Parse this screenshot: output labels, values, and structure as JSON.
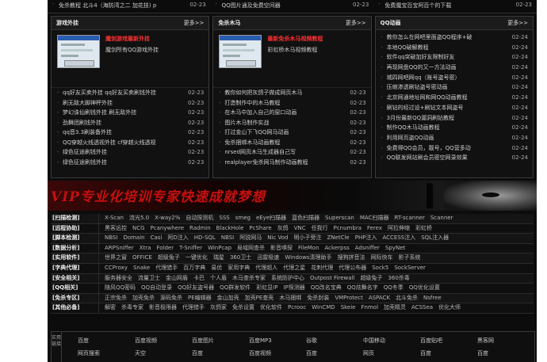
{
  "top_row": [
    {
      "text": "免杀教程 北斗4（海防湾之二 加花技) p",
      "date": "02-23"
    },
    {
      "text": "QQ图片通及免费空间器",
      "date": "02-23"
    },
    {
      "text": "免费魔宝百宝阿百个的下载",
      "date": "02-23"
    }
  ],
  "panels": [
    {
      "title": "游戏外挂",
      "more": "更多>>",
      "featured_title": "魔剑游戏最新外挂",
      "featured_desc": "魔剑所有QQ游戏外挂",
      "items": [
        {
          "text": "qq好友买卖外挂 qq好友买卖刷钱外挂",
          "date": "02-23"
        },
        {
          "text": "刷无敌大脚神秤外挂",
          "date": "02-23"
        },
        {
          "text": "梦幻诛仙刷钱外挂 刷无敌外挂",
          "date": "02-23"
        },
        {
          "text": "劲舞团刷钱外挂",
          "date": "02-23"
        },
        {
          "text": "qq音3.3刷装备外挂",
          "date": "02-23"
        },
        {
          "text": "QQ穿越火线透视外挂 cf穿越火线透视",
          "date": "02-23"
        },
        {
          "text": "绿色征途刷钱外挂",
          "date": "02-23"
        },
        {
          "text": "绿色征途刷钱外挂",
          "date": "02-23"
        }
      ]
    },
    {
      "title": "免杀木马",
      "more": "更多>>",
      "featured_title": "最新免杀木马视频教程",
      "featured_desc": "彩虹桥木马视频教程",
      "items": [
        {
          "text": "教你如何把灰鸽子做成网页木马",
          "date": "02-23"
        },
        {
          "text": "打造制作中的木马教程",
          "date": "02-23"
        },
        {
          "text": "在木马中加入自己的窗口动画",
          "date": "02-23"
        },
        {
          "text": "图片木马制作实战",
          "date": "02-23"
        },
        {
          "text": "打过金山下飞QQ网马动画",
          "date": "02-23"
        },
        {
          "text": "免杀捆绑木马动画教程",
          "date": "02-23"
        },
        {
          "text": "nrsed网页木马生成器自己写",
          "date": "02-23"
        },
        {
          "text": "realplayer免杀网马制作动画教程",
          "date": "02-23"
        }
      ]
    },
    {
      "title": "QQ动画",
      "more": "更多>>",
      "items": [
        {
          "text": "教你怎么在网吧里面盗QQ程序+破",
          "date": "02-24"
        },
        {
          "text": "本地QQ破解教程",
          "date": "02-24"
        },
        {
          "text": "软件qq突破加好友限制好友",
          "date": "02-24"
        },
        {
          "text": "再现网盘QQ的又一方法动画",
          "date": "02-24"
        },
        {
          "text": "城四网吧网qq（账号盗号密）",
          "date": "02-24"
        },
        {
          "text": "压缩渗透刷钻盗号密动画",
          "date": "02-24"
        },
        {
          "text": "北京网通地址网和网QQ动画教程",
          "date": "02-24"
        },
        {
          "text": "刷钻的经过设+刷钻文本网盗号",
          "date": "02-24"
        },
        {
          "text": "3月份最新QQ漏洞刷钻教程",
          "date": "02-24"
        },
        {
          "text": "制作QQ木马动画教程",
          "date": "02-24"
        },
        {
          "text": "利用网页盗QQ动画",
          "date": "02-24"
        },
        {
          "text": "免费得QQ会员，靓号，QQ营多动",
          "date": "02-24"
        },
        {
          "text": "QQ联发网站刷会员密空网录效果",
          "date": "02-24"
        }
      ]
    }
  ],
  "banner": {
    "text": "VIP专业化培训专家快速成就梦想"
  },
  "nav": [
    {
      "label": "[扫描检测]",
      "items": [
        "X-Scan",
        "流光5.0",
        "X-way2%",
        "自动探测机",
        "SSS",
        "smeg",
        "eEye扫描器",
        "蓝色扫描器",
        "Superscan",
        "MAC扫描器",
        "RT-scanner",
        "Scanner"
      ]
    },
    {
      "label": "[远程协助]",
      "items": [
        "黑客远控",
        "NCG",
        "Pcanywhere",
        "Radmin",
        "BlackHole",
        "PcShare",
        "灰鸽",
        "VNC",
        "任我行",
        "Pcnumbra",
        "Ferex",
        "阿拉伸缩",
        "彩虹桥"
      ]
    },
    {
      "label": "[脚本检测]",
      "items": [
        "NBSI",
        "Domain",
        "Casi",
        "阿D注入",
        "HD-SQL",
        "NBSI",
        "阿锐网马",
        "Nic Vod",
        "明小子旁注",
        "ZNetCle",
        "PHP注入",
        "ACCESS注入",
        "SQL注入器"
      ]
    },
    {
      "label": "[数据分析]",
      "items": [
        "ARPSniffer",
        "Xtra",
        "Folder",
        "T-Sniffer",
        "WinPcap",
        "局域网查杀",
        "影音嗅探",
        "FileMon",
        "Ackerpss",
        "Adsniffer",
        "SpyNet"
      ]
    },
    {
      "label": "[实用软件]",
      "items": [
        "世界之窗",
        "OFFICE",
        "超级兔子",
        "一键优化",
        "瑞星",
        "360卫士",
        "迅雷极速",
        "Windows清理助手",
        "搜狗拼音法",
        "网际快车",
        "影子系统"
      ]
    },
    {
      "label": "[字典代理]",
      "items": [
        "CCProxy",
        "Snake",
        "代理猎手",
        "百万字典",
        "易优",
        "家用字典",
        "代理超人",
        "代理之星",
        "花刺代理",
        "代理公布器",
        "Sock5",
        "SockServer"
      ]
    },
    {
      "label": "[安全相关]",
      "items": [
        "服务器安全",
        "流量卫士",
        "金山网盾",
        "卡巴",
        "个人盾",
        "木马查杀专家",
        "系统防护中心",
        "Outpost Firewall",
        "超级兔子",
        "360杀毒"
      ]
    },
    {
      "label": "[QQ相关]",
      "items": [
        "随风QQ密码",
        "QQ自动登录",
        "QQ好友盗号器",
        "QQ群发软件",
        "彩虹显IP",
        "IP探测器",
        "QQ改名宝典",
        "QQ炫舞名字",
        "QQ冬季",
        "QQ优化设置"
      ]
    },
    {
      "label": "[免杀专区]",
      "items": [
        "正宗免杀",
        "加壳免杀",
        "源码免杀",
        "PE编辑器",
        "金山加壳",
        "加壳PE查壳",
        "木马捆绑",
        "免杀封装",
        "VMProtect",
        "ASPACK",
        "北斗免杀",
        "Nsfree"
      ]
    },
    {
      "label": "[其他必备]",
      "items": [
        "解密",
        "杀毒专家",
        "影音极限器",
        "代理猎手",
        "灰鸽家",
        "免杀设置",
        "优化软件",
        "Pcrooc",
        "WinCMD",
        "Skeie",
        "Fnmol",
        "加壳精灵",
        "ACSSea",
        "优化大师"
      ]
    }
  ],
  "bottom": {
    "side_label": "实用链接",
    "links": [
      "百度",
      "百度视频",
      "百度图片",
      "百度MP3",
      "谷歌",
      "中国移动",
      "百度贴吧",
      "黑客网",
      "网页搜索",
      "天空",
      "百度",
      "百度视频",
      "百度",
      "网页",
      "百度",
      "百度"
    ]
  }
}
